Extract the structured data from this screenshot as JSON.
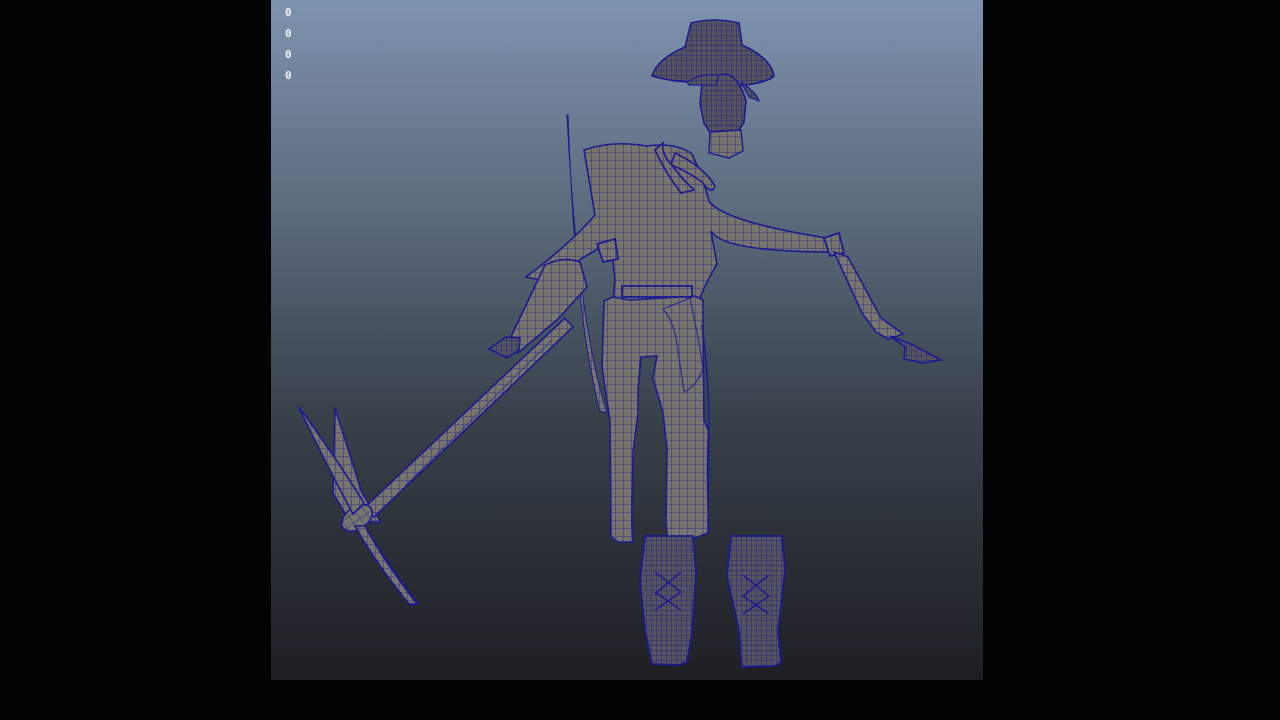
{
  "viewport": {
    "hud_values": [
      "0",
      "0",
      "0",
      "0"
    ],
    "background_colors": {
      "top": "#7e93ae",
      "bottom": "#1d1f24"
    },
    "letterbox_color": "#030303"
  },
  "model": {
    "display_mode": "wireframe-on-shaded",
    "wire_color": "#1c1a8f",
    "surface_color": "#77746d"
  }
}
